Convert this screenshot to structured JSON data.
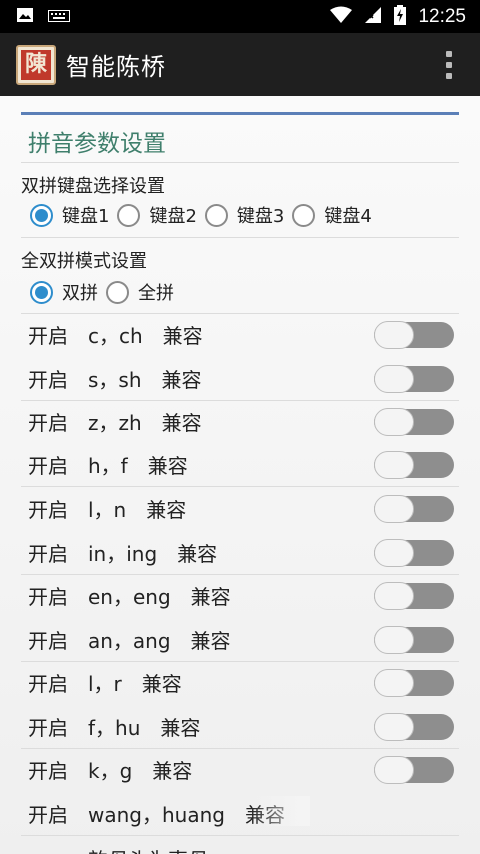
{
  "status_bar": {
    "time": "12:25",
    "icons": [
      "image-icon",
      "keyboard-icon",
      "wifi-icon",
      "signal-icon",
      "battery-charging-icon"
    ]
  },
  "app_bar": {
    "icon_glyph": "陳",
    "title": "智能陈桥",
    "overflow_icon": "overflow-menu-icon"
  },
  "settings": {
    "section_title": "拼音参数设置",
    "keyboard_group": {
      "label": "双拼键盘选择设置",
      "options": [
        "键盘1",
        "键盘2",
        "键盘3",
        "键盘4"
      ],
      "selected": "键盘1"
    },
    "mode_group": {
      "label": "全双拼模式设置",
      "options": [
        "双拼",
        "全拼"
      ],
      "selected": "双拼"
    },
    "compat_options": [
      {
        "label": "开启　c，ch　兼容",
        "enabled": false
      },
      {
        "label": "开启　s，sh　兼容",
        "enabled": false
      },
      {
        "label": "开启　z，zh　兼容",
        "enabled": false
      },
      {
        "label": "开启　h，f　兼容",
        "enabled": false
      },
      {
        "label": "开启　l，n　兼容",
        "enabled": false
      },
      {
        "label": "开启　in，ing　兼容",
        "enabled": false
      },
      {
        "label": "开启　en，eng　兼容",
        "enabled": false
      },
      {
        "label": "开启　an，ang　兼容",
        "enabled": false
      },
      {
        "label": "开启　l，r　兼容",
        "enabled": false
      },
      {
        "label": "开启　f，hu　兼容",
        "enabled": false
      },
      {
        "label": "开启　k，g　兼容",
        "enabled": false
      },
      {
        "label": "开启　wang，huang　兼容",
        "enabled": false
      }
    ],
    "partial_next_label": "　　　韵母头为声母"
  }
}
